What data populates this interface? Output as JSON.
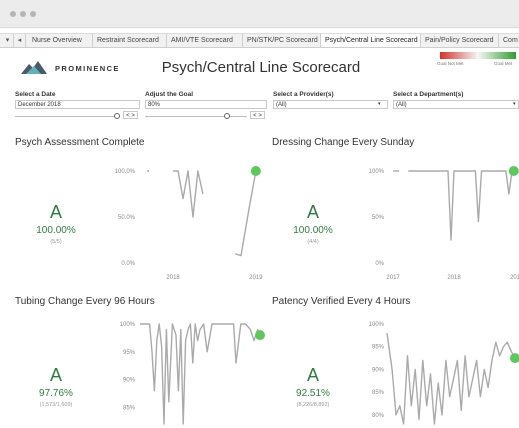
{
  "tabs": {
    "nav_back": "◂",
    "items": [
      {
        "label": "Nurse Overview",
        "active": false
      },
      {
        "label": "Restraint Scorecard",
        "active": false
      },
      {
        "label": "AMI/VTE Scorecard",
        "active": false
      },
      {
        "label": "PN/STK/PC Scorecard",
        "active": false
      },
      {
        "label": "Psych/Central Line Scorecard",
        "active": true
      },
      {
        "label": "Pain/Policy Scorecard",
        "active": false
      },
      {
        "label": "Com",
        "active": false
      }
    ]
  },
  "header": {
    "brand": "PROMINENCE",
    "title": "Psych/Central Line Scorecard",
    "legend_left": "Goal Not Met",
    "legend_right": "Goal Met",
    "legend_colors": [
      "#d73027",
      "#2ca02c"
    ]
  },
  "filters": {
    "date": {
      "label": "Select a Date",
      "value": "December 2018",
      "arrows": "< >"
    },
    "goal": {
      "label": "Adjust the Goal",
      "value": "80%",
      "arrows": "< >"
    },
    "provider": {
      "label": "Select a Provider(s)",
      "value": "(All)",
      "caret": "▾"
    },
    "department": {
      "label": "Select a Department(s)",
      "value": "(All)",
      "caret": "▾"
    }
  },
  "colors": {
    "grade": "#2e7d3e",
    "line": "#aaaaaa",
    "marker": "#5cc95c"
  },
  "panels": [
    {
      "title": "Psych Assessment Complete",
      "grade": "A",
      "percent": "100.00%",
      "fraction": "(5/5)"
    },
    {
      "title": "Dressing Change Every Sunday",
      "grade": "A",
      "percent": "100.00%",
      "fraction": "(4/4)"
    },
    {
      "title": "Tubing Change Every 96 Hours",
      "grade": "A",
      "percent": "97.76%",
      "fraction": "(1,573/1,609)"
    },
    {
      "title": "Patency Verified Every 4 Hours",
      "grade": "A",
      "percent": "92.51%",
      "fraction": "(8,226/8,892)"
    }
  ],
  "chart_data": [
    {
      "type": "line",
      "title": "Psych Assessment Complete",
      "y_tick_labels": [
        "100.0%",
        "50.0%",
        "0.0%"
      ],
      "x_tick_labels": [
        "2018",
        "2019"
      ],
      "ylim": [
        0,
        100
      ],
      "xlim": [
        2017.6,
        2019.05
      ],
      "series": [
        {
          "x": [
            2017.7
          ],
          "values": [
            100
          ]
        },
        {
          "x": [
            2018.0,
            2018.06,
            2018.12,
            2018.18,
            2018.24,
            2018.3,
            2018.36
          ],
          "values": [
            100,
            100,
            70,
            100,
            50,
            100,
            75
          ]
        },
        {
          "x": [
            2018.75,
            2018.82,
            2018.92,
            2019.0
          ],
          "values": [
            10,
            8,
            60,
            100
          ]
        }
      ],
      "marker": {
        "x": 2019.0,
        "value": 100
      }
    },
    {
      "type": "line",
      "title": "Dressing Change Every Sunday",
      "y_tick_labels": [
        "100%",
        "50%",
        "0%"
      ],
      "x_tick_labels": [
        "2017",
        "2018",
        "201"
      ],
      "ylim": [
        0,
        100
      ],
      "xlim": [
        2016.9,
        2019.0
      ],
      "series": [
        {
          "x": [
            2017.0,
            2017.1
          ],
          "values": [
            100,
            100
          ]
        },
        {
          "x": [
            2017.25,
            2017.9,
            2017.95,
            2018.0,
            2018.2,
            2018.35,
            2018.4,
            2018.45,
            2018.85,
            2018.9,
            2018.95
          ],
          "values": [
            100,
            100,
            25,
            100,
            100,
            100,
            45,
            100,
            100,
            75,
            100
          ]
        }
      ],
      "marker": {
        "x": 2018.98,
        "value": 100
      }
    },
    {
      "type": "line",
      "title": "Tubing Change Every 96 Hours",
      "y_tick_labels": [
        "100%",
        "95%",
        "90%",
        "85%"
      ],
      "ylim": [
        82,
        100
      ],
      "series": [
        {
          "x": [
            0,
            6,
            8,
            10,
            12,
            14,
            16,
            18,
            20,
            22,
            24,
            27,
            30,
            32,
            34,
            36,
            38,
            40,
            42,
            44,
            46,
            48,
            50,
            53,
            56,
            60,
            63,
            66,
            70,
            74,
            78,
            80,
            84,
            88,
            92,
            95,
            98,
            100
          ],
          "values": [
            100,
            100,
            100,
            95,
            88,
            97,
            100,
            96,
            82,
            99,
            86,
            100,
            98,
            88,
            99,
            82,
            97,
            99,
            100,
            93,
            100,
            97,
            99,
            100,
            95,
            100,
            100,
            100,
            100,
            100,
            100,
            93,
            100,
            100,
            99,
            97,
            99,
            98
          ]
        }
      ],
      "marker": {
        "x": 100,
        "value": 98
      }
    },
    {
      "type": "line",
      "title": "Patency Verified Every 4 Hours",
      "y_tick_labels": [
        "100%",
        "95%",
        "90%",
        "85%",
        "80%"
      ],
      "ylim": [
        78,
        100
      ],
      "series": [
        {
          "x": [
            0,
            4,
            7,
            10,
            13,
            16,
            19,
            22,
            25,
            28,
            31,
            34,
            37,
            40,
            43,
            46,
            49,
            52,
            55,
            58,
            61,
            64,
            67,
            70,
            73,
            76,
            79,
            82,
            85,
            88,
            91,
            94,
            97,
            100
          ],
          "values": [
            98,
            90,
            80,
            82,
            78,
            93,
            82,
            90,
            79,
            92,
            82,
            89,
            78,
            87,
            80,
            92,
            84,
            88,
            92,
            81,
            93,
            84,
            88,
            92,
            84,
            90,
            86,
            92,
            96,
            93,
            95,
            96,
            94,
            92.5
          ]
        }
      ],
      "marker": {
        "x": 100,
        "value": 92.5
      }
    }
  ]
}
